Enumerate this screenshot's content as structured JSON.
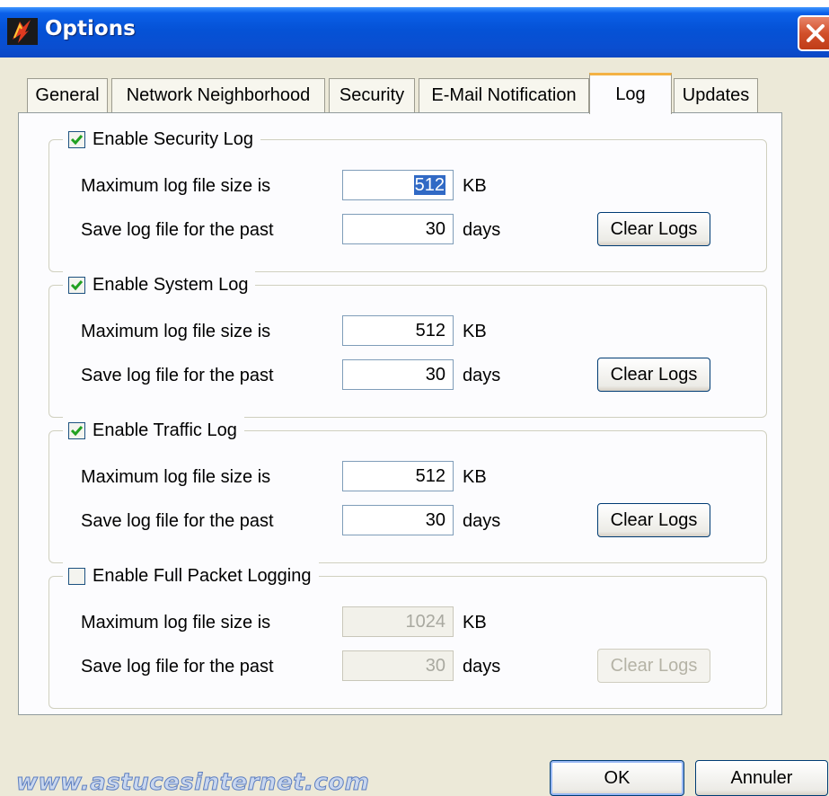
{
  "window": {
    "title": "Options"
  },
  "tabs": [
    {
      "label": "General"
    },
    {
      "label": "Network Neighborhood"
    },
    {
      "label": "Security"
    },
    {
      "label": "E-Mail Notification"
    },
    {
      "label": "Log",
      "active": true
    },
    {
      "label": "Updates"
    }
  ],
  "groups": {
    "security": {
      "label": "Enable Security Log",
      "checked": true,
      "max_size_label": "Maximum log file size is",
      "max_size_value": "512",
      "max_size_unit": "KB",
      "save_label": "Save log file for the past",
      "save_value": "30",
      "save_unit": "days",
      "clear_label": "Clear Logs"
    },
    "system": {
      "label": "Enable System Log",
      "checked": true,
      "max_size_label": "Maximum log file size is",
      "max_size_value": "512",
      "max_size_unit": "KB",
      "save_label": "Save log file for the past",
      "save_value": "30",
      "save_unit": "days",
      "clear_label": "Clear Logs"
    },
    "traffic": {
      "label": "Enable Traffic Log",
      "checked": true,
      "max_size_label": "Maximum log file size is",
      "max_size_value": "512",
      "max_size_unit": "KB",
      "save_label": "Save log file for the past",
      "save_value": "30",
      "save_unit": "days",
      "clear_label": "Clear Logs"
    },
    "packet": {
      "label": "Enable Full Packet Logging",
      "checked": false,
      "max_size_label": "Maximum log file size is",
      "max_size_value": "1024",
      "max_size_unit": "KB",
      "save_label": "Save log file for the past",
      "save_value": "30",
      "save_unit": "days",
      "clear_label": "Clear Logs"
    }
  },
  "buttons": {
    "ok": "OK",
    "cancel": "Annuler"
  },
  "watermark": "www.astucesinternet.com",
  "colors": {
    "titlebar": "#0552d6",
    "accent_tab": "#f4b244",
    "selection": "#316ac5"
  }
}
